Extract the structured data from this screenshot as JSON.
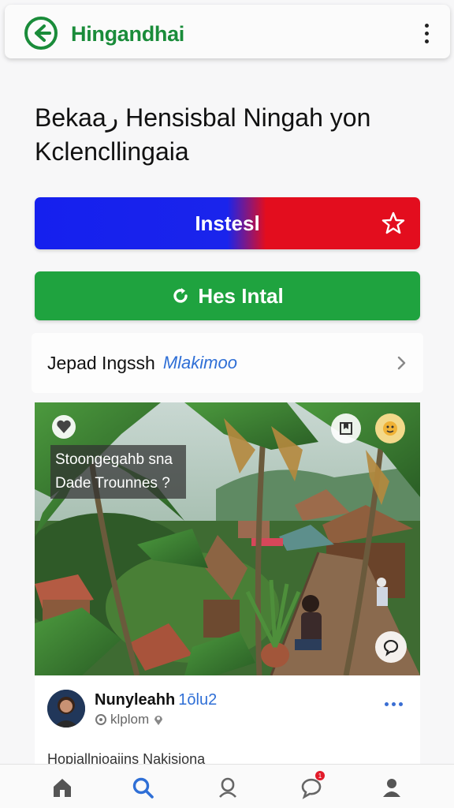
{
  "header": {
    "title": "Hingandhai",
    "back_icon": "arrow-left-circle-icon",
    "menu_icon": "kebab-menu-icon",
    "accent_color": "#1a8c3a"
  },
  "main": {
    "heading": "Bekaaر Hensisbal Ningah yon Kclencllingaia",
    "install_label": "Instesl",
    "install_icon": "star-outline-icon",
    "has_install_label": "Hes Intal",
    "has_install_icon": "refresh-icon",
    "link_row": {
      "label": "Jepad Ingssh",
      "accent": "Mlakimoo",
      "icon": "chevron-right-icon"
    }
  },
  "photo": {
    "caption_line1": "Stoongegahb sna",
    "caption_line2": "Dade Trounnes ?",
    "icons": [
      "heart-icon",
      "bookmark-icon",
      "emoji-icon",
      "comment-icon"
    ]
  },
  "post": {
    "author": "Nunyleahh",
    "tag": "1ōlu2",
    "meta": "klplom",
    "text": "Hopiallnioaiins Nakisiona"
  },
  "bottom_nav": {
    "items": [
      "home-icon",
      "search-icon",
      "profile-outline-icon",
      "chat-icon",
      "user-icon"
    ],
    "badge": "1",
    "active_color": "#2f6fd6"
  }
}
